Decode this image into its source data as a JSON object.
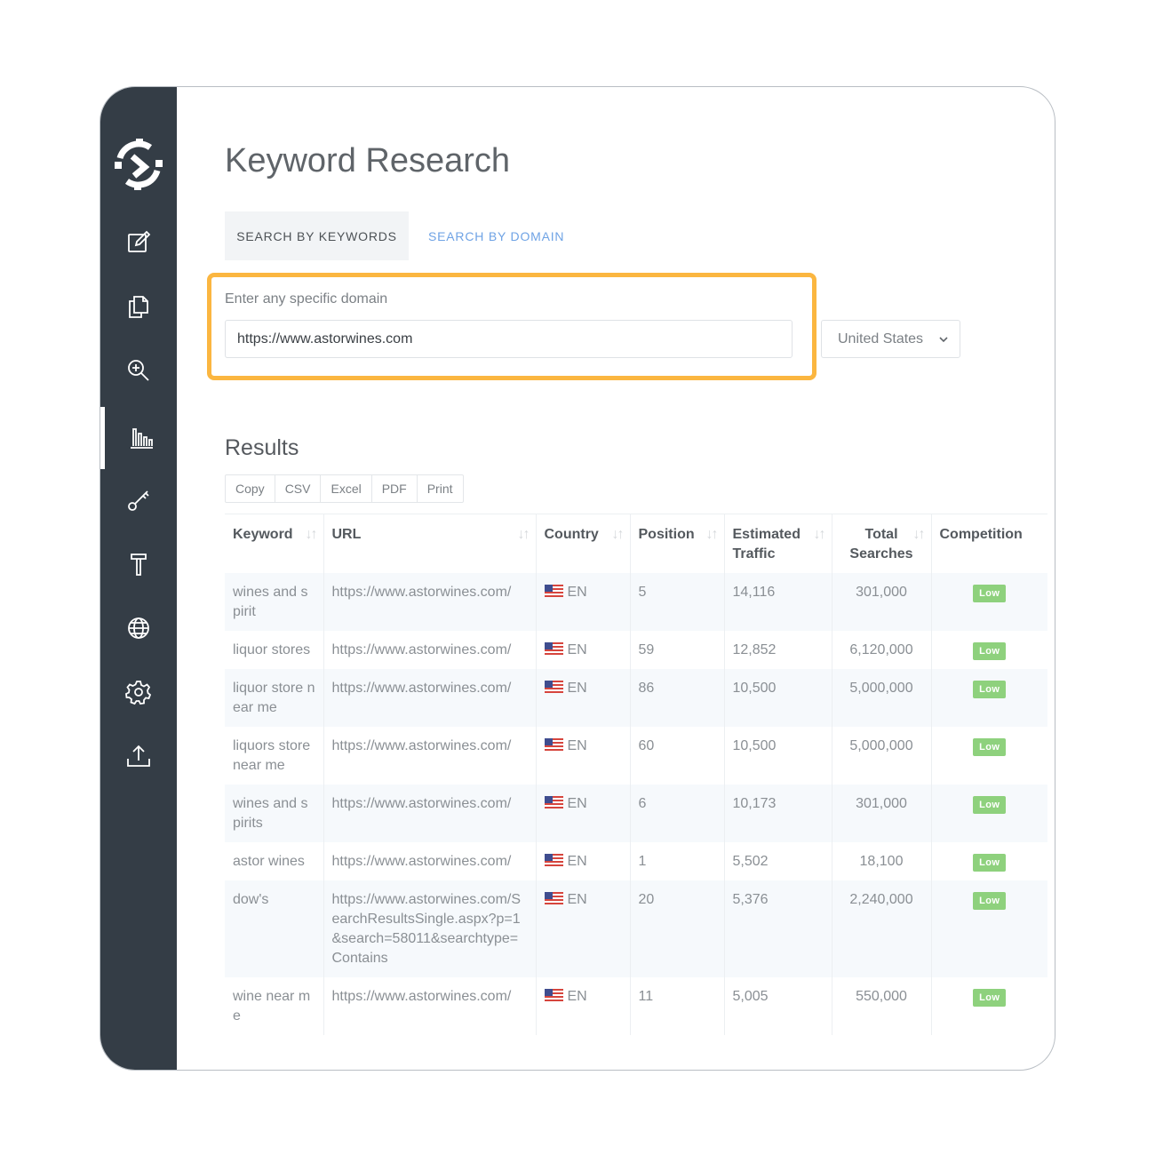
{
  "page": {
    "title": "Keyword Research"
  },
  "tabs": {
    "keywords": "SEARCH BY KEYWORDS",
    "domain": "SEARCH BY DOMAIN"
  },
  "search": {
    "label": "Enter any specific domain",
    "value": "https://www.astorwines.com",
    "country": "United States"
  },
  "results": {
    "title": "Results",
    "export_buttons": [
      "Copy",
      "CSV",
      "Excel",
      "PDF",
      "Print"
    ],
    "columns": {
      "keyword": "Keyword",
      "url": "URL",
      "country": "Country",
      "position": "Position",
      "traffic": "Estimated Traffic",
      "searches": "Total Searches",
      "competition": "Competition"
    },
    "rows": [
      {
        "keyword": "wines and spirit",
        "url": "https://www.astorwines.com/",
        "country": "EN",
        "position": "5",
        "traffic": "14,116",
        "searches": "301,000",
        "competition": "Low"
      },
      {
        "keyword": "liquor stores",
        "url": "https://www.astorwines.com/",
        "country": "EN",
        "position": "59",
        "traffic": "12,852",
        "searches": "6,120,000",
        "competition": "Low"
      },
      {
        "keyword": "liquor store near me",
        "url": "https://www.astorwines.com/",
        "country": "EN",
        "position": "86",
        "traffic": "10,500",
        "searches": "5,000,000",
        "competition": "Low"
      },
      {
        "keyword": "liquors store near me",
        "url": "https://www.astorwines.com/",
        "country": "EN",
        "position": "60",
        "traffic": "10,500",
        "searches": "5,000,000",
        "competition": "Low"
      },
      {
        "keyword": "wines and spirits",
        "url": "https://www.astorwines.com/",
        "country": "EN",
        "position": "6",
        "traffic": "10,173",
        "searches": "301,000",
        "competition": "Low"
      },
      {
        "keyword": "astor wines",
        "url": "https://www.astorwines.com/",
        "country": "EN",
        "position": "1",
        "traffic": "5,502",
        "searches": "18,100",
        "competition": "Low"
      },
      {
        "keyword": "dow's",
        "url": "https://www.astorwines.com/SearchResultsSingle.aspx?p=1&search=58011&searchtype=Contains",
        "country": "EN",
        "position": "20",
        "traffic": "5,376",
        "searches": "2,240,000",
        "competition": "Low"
      },
      {
        "keyword": "wine near me",
        "url": "https://www.astorwines.com/",
        "country": "EN",
        "position": "11",
        "traffic": "5,005",
        "searches": "550,000",
        "competition": "Low"
      }
    ]
  },
  "colors": {
    "sidebar": "#343d46",
    "highlight": "#fbb640",
    "badge": "#8ed17d",
    "tab_active_text": "#6fa3e5"
  },
  "icons": [
    "logo-icon",
    "edit-icon",
    "copy-icon",
    "zoom-in-icon",
    "bar-chart-icon",
    "key-icon",
    "hammer-icon",
    "globe-icon",
    "gear-icon",
    "upload-icon",
    "us-flag-icon",
    "sort-icon",
    "chevron-down-icon"
  ]
}
